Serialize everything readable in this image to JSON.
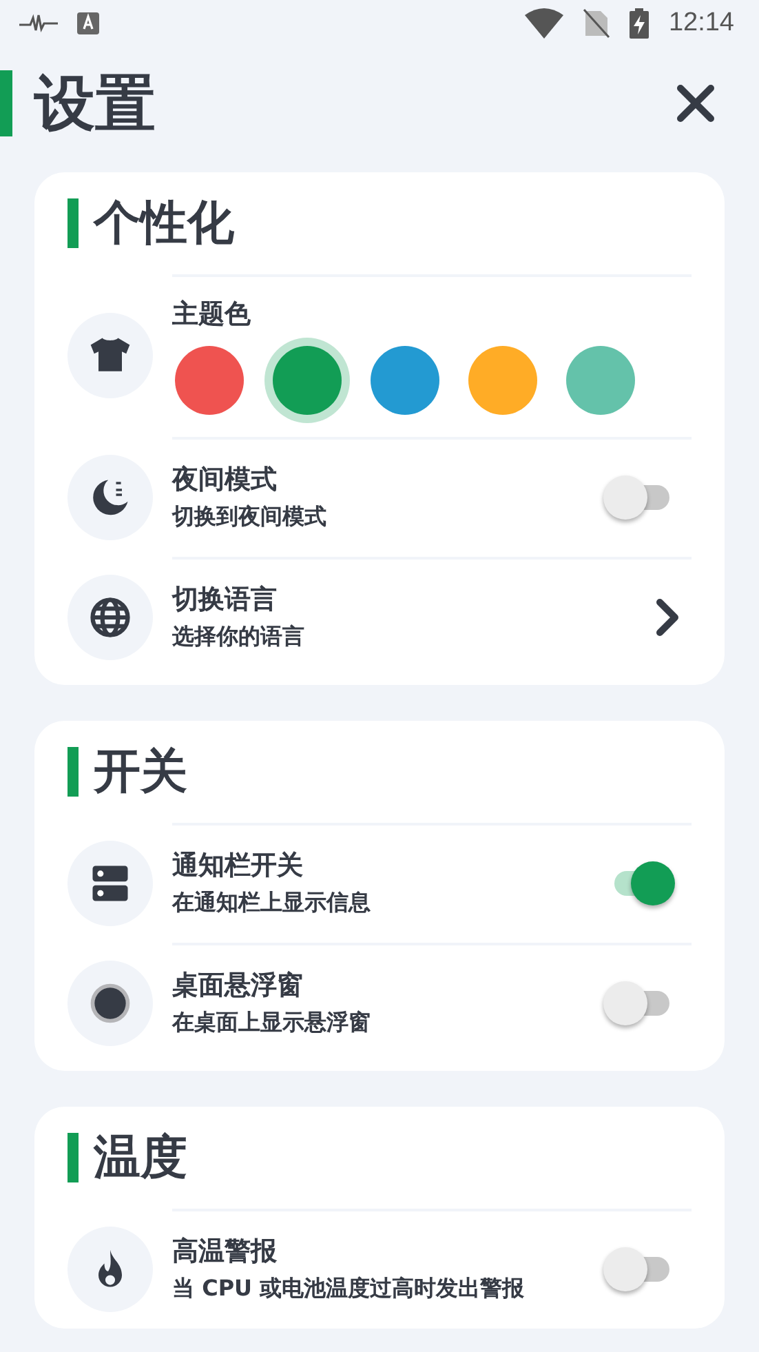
{
  "status_bar": {
    "time": "12:14"
  },
  "header": {
    "title": "设置"
  },
  "sections": [
    {
      "title": "个性化",
      "rows": [
        {
          "kind": "colors",
          "title": "主题色",
          "swatches": [
            {
              "color": "#ef5350",
              "selected": false
            },
            {
              "color": "#129d55",
              "selected": true
            },
            {
              "color": "#239ad2",
              "selected": false
            },
            {
              "color": "#ffac26",
              "selected": false
            },
            {
              "color": "#64c2aa",
              "selected": false
            }
          ]
        },
        {
          "kind": "toggle",
          "title": "夜间模式",
          "subtitle": "切换到夜间模式",
          "on": false
        },
        {
          "kind": "link",
          "title": "切换语言",
          "subtitle": "选择你的语言"
        }
      ]
    },
    {
      "title": "开关",
      "rows": [
        {
          "kind": "toggle",
          "title": "通知栏开关",
          "subtitle": "在通知栏上显示信息",
          "on": true
        },
        {
          "kind": "toggle",
          "title": "桌面悬浮窗",
          "subtitle": "在桌面上显示悬浮窗",
          "on": false
        }
      ]
    },
    {
      "title": "温度",
      "rows": [
        {
          "kind": "toggle",
          "title": "高温警报",
          "subtitle": "当 CPU 或电池温度过高时发出警报",
          "on": false
        }
      ]
    }
  ]
}
